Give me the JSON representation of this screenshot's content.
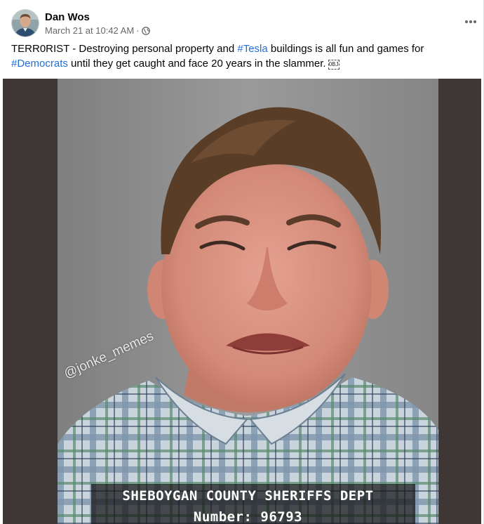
{
  "post": {
    "author": "Dan Wos",
    "timestamp": "March 21 at 10:42 AM",
    "separator": "·",
    "privacy_icon": "globe-icon",
    "more_icon": "more-options-icon",
    "text": {
      "part1": "TERR0RIST - Destroying personal property and ",
      "hashtag1": "#Tesla",
      "part2": " buildings is all fun and games for ",
      "hashtag2": "#Democrats",
      "part3": " until they get caught and face 20 years in the slammer.",
      "glyph": "OBJ"
    },
    "colors": {
      "hashtag": "#216fdb",
      "meta_text": "#65676b",
      "media_background": "#3f3636"
    }
  },
  "media": {
    "watermark": "@jonke_memes",
    "caption_line1": "SHEBOYGAN COUNTY SHERIFFS DEPT",
    "caption_line2": "Number: 96793"
  }
}
